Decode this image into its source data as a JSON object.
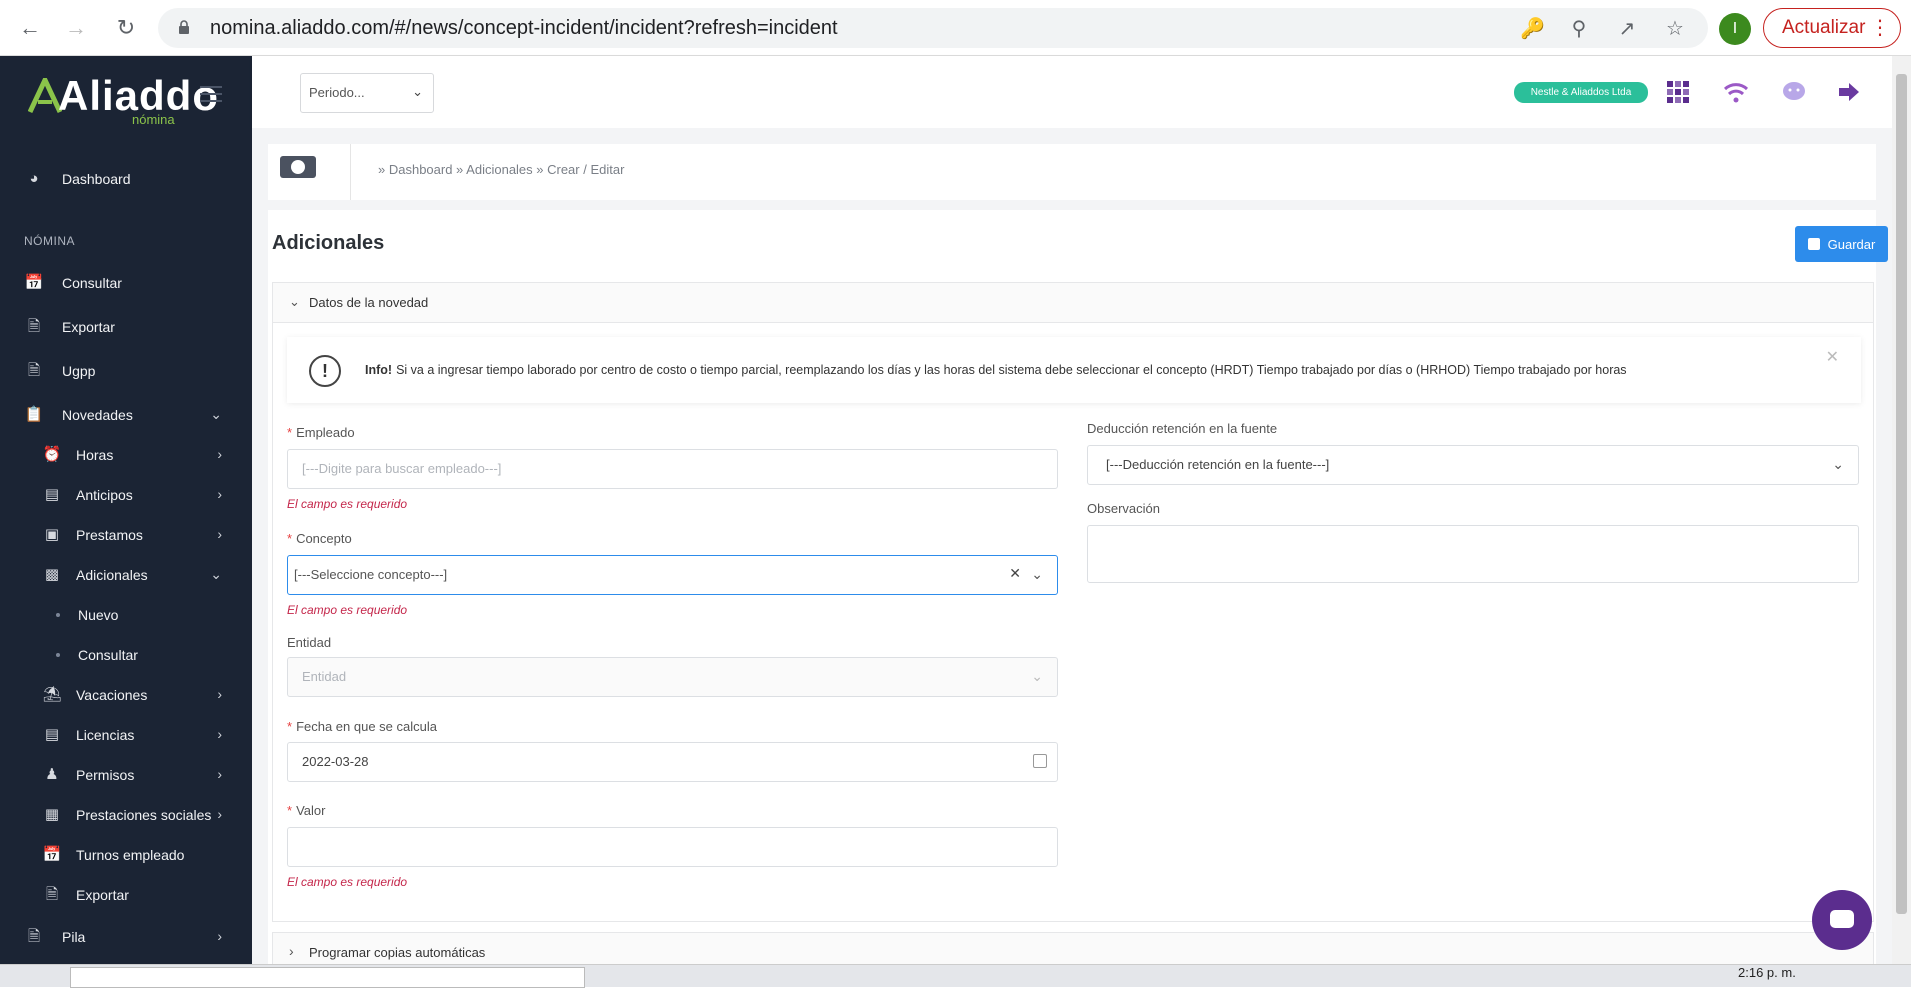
{
  "browser": {
    "url": "nomina.aliaddo.com/#/news/concept-incident/incident?refresh=incident",
    "profile_initial": "I",
    "update_label": "Actualizar"
  },
  "sidebar": {
    "logo_text": "Aliaddo",
    "logo_sub": "nómina",
    "dashboard": "Dashboard",
    "section_nomina": "NÓMINA",
    "items": [
      {
        "label": "Consultar",
        "icon": "calendar-check-icon"
      },
      {
        "label": "Exportar",
        "icon": "excel-file-icon"
      },
      {
        "label": "Ugpp",
        "icon": "excel-file-icon"
      },
      {
        "label": "Novedades",
        "icon": "clipboard-icon",
        "expanded": true
      }
    ],
    "novedades_sub": [
      {
        "label": "Horas",
        "icon": "alarm-clock-icon"
      },
      {
        "label": "Anticipos",
        "icon": "id-card-icon"
      },
      {
        "label": "Prestamos",
        "icon": "credit-card-icon"
      },
      {
        "label": "Adicionales",
        "icon": "money-bill-icon",
        "expanded": true
      },
      {
        "label": "Vacaciones",
        "icon": "umbrella-beach-icon"
      },
      {
        "label": "Licencias",
        "icon": "bed-icon"
      },
      {
        "label": "Permisos",
        "icon": "user-clock-icon"
      },
      {
        "label": "Prestaciones sociales",
        "icon": "calculator-icon"
      },
      {
        "label": "Turnos empleado",
        "icon": "calendar-x-icon"
      },
      {
        "label": "Exportar",
        "icon": "excel-file-icon"
      }
    ],
    "adicionales_sub": [
      "Nuevo",
      "Consultar"
    ],
    "pila": "Pila"
  },
  "topbar": {
    "periodo_placeholder": "Periodo...",
    "company": "Nestle & Aliaddos Ltda"
  },
  "breadcrumb": "» Dashboard » Adicionales » Crear / Editar",
  "page": {
    "title": "Adicionales",
    "save_label": "Guardar"
  },
  "panel": {
    "title": "Datos de la novedad",
    "alert_title": "Info!",
    "alert_text": "Si va a ingresar tiempo laborado por centro de costo o tiempo parcial, reemplazando los días y las horas del sistema debe seleccionar el concepto (HRDT) Tiempo trabajado por días o (HRHOD) Tiempo trabajado por horas"
  },
  "form": {
    "empleado_label": "Empleado",
    "empleado_placeholder": "[---Digite para buscar empleado---]",
    "concepto_label": "Concepto",
    "concepto_value": "[---Seleccione concepto---]",
    "entidad_label": "Entidad",
    "entidad_placeholder": "Entidad",
    "fecha_label": "Fecha en que se calcula",
    "fecha_value": "2022-03-28",
    "valor_label": "Valor",
    "valor_value": "",
    "required_error": "El campo es requerido",
    "deduccion_label": "Deducción retención en la fuente",
    "deduccion_value": "[---Deducción retención en la fuente---]",
    "observacion_label": "Observación"
  },
  "panel2": {
    "title": "Programar copias automáticas"
  },
  "taskbar": {
    "time": "2:16 p. m."
  },
  "colors": {
    "sidebar_bg": "#1b2434",
    "primary": "#2d8ceb",
    "error": "#c4264a",
    "badge": "#2bbf9a",
    "chat": "#5b2d8e"
  }
}
